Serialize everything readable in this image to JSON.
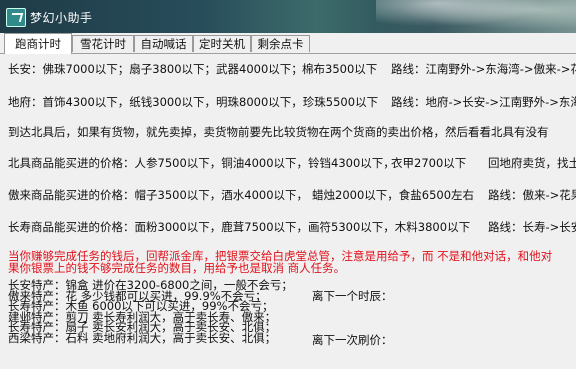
{
  "window": {
    "title": "梦幻小助手",
    "icon": "app-icon"
  },
  "tabs": [
    {
      "label": "跑商计时",
      "active": true
    },
    {
      "label": "雪花计时",
      "active": false
    },
    {
      "label": "自动喊话",
      "active": false
    },
    {
      "label": "定时关机",
      "active": false
    },
    {
      "label": "剩余点卡",
      "active": false
    }
  ],
  "rows": {
    "changan": {
      "prices": "长安：佛珠7000以下；扇子3800以下；武器4000以下；",
      "cloth": "棉布3500以下",
      "route": "路线：江南野外->东海湾->傲来->花果"
    },
    "difu": {
      "prices": "地府：首饰4300以下，纸钱3000以下，明珠8000以下，珍珠5500以下",
      "route": "路线：地府->长安->江南野外->东海湾"
    },
    "beiju_tip": "到达北具后，如果有货物，就先卖掉，卖货物前要先比较货物在两个货商的卖出价格，然后看看北具有没有",
    "beiju": {
      "prices": "北具商品能买进的价格：人参7500以下，铜油4000以下，铃铛4300以下，",
      "extra": "衣甲2700以下",
      "route": "回地府卖货，找土"
    },
    "aolai": {
      "prices": "傲来商品能买进的价格：帽子3500以下，酒水4000以下，",
      "extra": "蜡烛2000以下，食盐6500左右",
      "route": "路线：傲来->花果"
    },
    "changshou": {
      "prices": "长寿商品能买进的价格：面粉3000以下，鹿茸7500以下，画符5300以下，木料3800以下",
      "route": "路线：长寿->长安"
    }
  },
  "notice": {
    "line1": "当你赚够完成任务的钱后，回帮派金库，把银票交给白虎堂总管，注意是用给予，而 不是和他对话，和他对",
    "line2": "果你银票上的钱不够完成任务的数目，用给予也是取消 商人任务。"
  },
  "specials": [
    "长安特产：锦盒   进价在3200-6800之间，一般不会亏；",
    "傲来特产：花     多少钱都可以买进，99.9%不会亏；",
    "长寿特产：木鱼   6000以下可以买进，99%不会亏；",
    "建邺特产：剪刀   卖长寿利润大，高于卖长寿、傲来；",
    "长寿特产：扇子   卖长安利润大，高于卖长安、北俱；",
    "西梁特产：石料   卖地府利润大，高于卖长安、北俱；"
  ],
  "side": {
    "next_time_label": "离下一个时辰：",
    "next_refresh_label": "离下一次刷价："
  }
}
